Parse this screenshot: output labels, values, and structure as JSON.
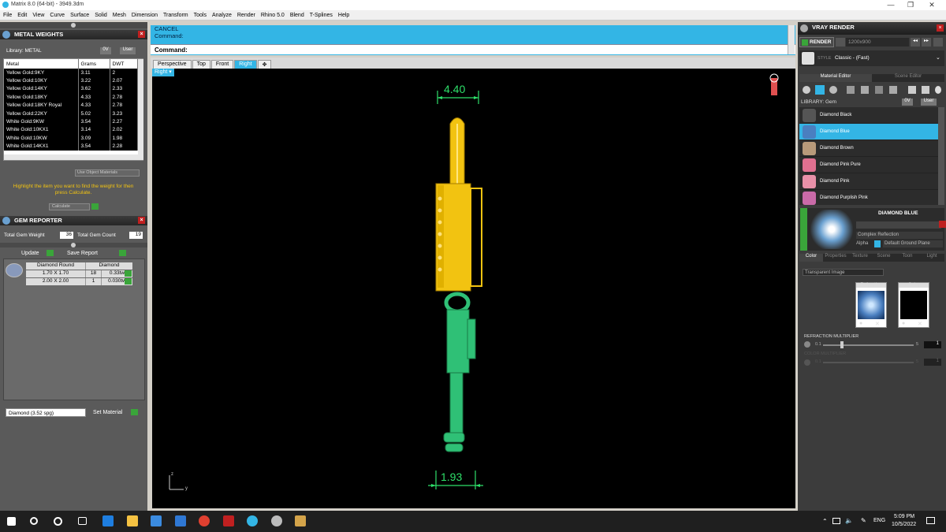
{
  "window": {
    "title": "Matrix 8.0 (64-bit) - 3949.3dm",
    "controls": [
      "—",
      "❐",
      "✕"
    ]
  },
  "menu": [
    "File",
    "Edit",
    "View",
    "Curve",
    "Surface",
    "Solid",
    "Mesh",
    "Dimension",
    "Transform",
    "Tools",
    "Analyze",
    "Render",
    "Rhino 5.0",
    "Blend",
    "T-Splines",
    "Help"
  ],
  "metal_weights": {
    "title": "METAL WEIGHTS",
    "library_label": "Library: METAL",
    "filters": [
      "0V",
      "User"
    ],
    "columns": [
      "Metal",
      "Grams",
      "DWT"
    ],
    "rows": [
      [
        "Yellow Gold:9KY",
        "3.11",
        "2"
      ],
      [
        "Yellow Gold:10KY",
        "3.22",
        "2.07"
      ],
      [
        "Yellow Gold:14KY",
        "3.62",
        "2.33"
      ],
      [
        "Yellow Gold:18KY",
        "4.33",
        "2.78"
      ],
      [
        "Yellow Gold:18KY Royal",
        "4.33",
        "2.78"
      ],
      [
        "Yellow Gold:22KY",
        "5.02",
        "3.23"
      ],
      [
        "White Gold:9KW",
        "3.54",
        "2.27"
      ],
      [
        "White Gold:10KX1",
        "3.14",
        "2.02"
      ],
      [
        "White Gold:10KW",
        "3.09",
        "1.98"
      ],
      [
        "White Gold:14KX1",
        "3.54",
        "2.28"
      ]
    ],
    "use_object_materials": "Use Object Materials",
    "instruction": "Highlight the item you want to find the weight for then press Calculate.",
    "calculate": "Calculate"
  },
  "gem_reporter": {
    "title": "GEM REPORTER",
    "total_weight_label": "Total Gem Weight",
    "total_weight_value": "36",
    "total_count_label": "Total Gem Count",
    "total_count_value": "19",
    "update": "Update",
    "save_report": "Save Report",
    "header": [
      "Diamond Round",
      "Diamond"
    ],
    "rows": [
      [
        "1.70 X 1.70",
        "18",
        "0.33tw"
      ],
      [
        "2.00 X 2.00",
        "1",
        "0.030tw"
      ]
    ],
    "material_select": "Diamond    (3.52 spg)",
    "set_material": "Set Material"
  },
  "command": {
    "line1": "CANCEL",
    "line2": "Command:",
    "prompt": "Command:"
  },
  "viewport_tabs": [
    "Perspective",
    "Top",
    "Front",
    "Right"
  ],
  "active_view": "Right",
  "viewport": {
    "label": "Right",
    "dim_top": "4.40",
    "dim_bottom": "1.93",
    "axis_z": "z",
    "axis_y": "y"
  },
  "vray": {
    "title": "VRAY RENDER",
    "render": "RENDER",
    "resolution": "1200x900",
    "style_label": "STYLE",
    "style_value": "Classic - (Fast)",
    "tabs": [
      "Material Editor",
      "Scene Editor"
    ],
    "library_label": "LIBRARY: Gem",
    "filters": [
      "0V",
      "User"
    ],
    "materials": [
      {
        "name": "Diamond Black",
        "color": "#555555"
      },
      {
        "name": "Diamond Blue",
        "color": "#4a7fc0"
      },
      {
        "name": "Diamond Brown",
        "color": "#b89a7a"
      },
      {
        "name": "Diamond Pink Pure",
        "color": "#e07090"
      },
      {
        "name": "Diamond Pink",
        "color": "#e890a8"
      },
      {
        "name": "Diamond Purplish Pink",
        "color": "#c96aa8"
      }
    ],
    "selected_material": "DIAMOND BLUE",
    "reflection": "Complex Reflection",
    "alpha": "Alpha",
    "ground": "Default Ground Plane",
    "prop_tabs": [
      "Color",
      "Properties",
      "Texture",
      "Scene",
      "Toon",
      "Light"
    ],
    "transparent": "Transparent Image",
    "refraction": "Refraction",
    "color": "Color",
    "refraction_multiplier": "REFRACTION MULTIPLIER",
    "slider_min": "0.1",
    "slider_max": "5",
    "slider_value": "1",
    "color_multiplier": "COLOR MULTIPLIER",
    "slider2_min": "0.1",
    "slider2_max": "5",
    "slider2_value": "1"
  },
  "taskbar": {
    "lang": "ENG",
    "time": "5:09 PM",
    "date": "10/5/2022"
  }
}
